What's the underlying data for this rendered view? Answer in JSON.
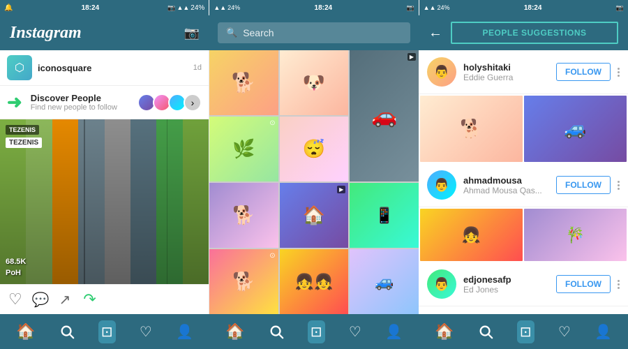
{
  "status_bars": [
    {
      "left_text": "🔔",
      "signal": "▲▲▲",
      "battery": "24%",
      "time": "18:24",
      "extra_icon": "📷"
    },
    {
      "signal": "▲▲▲",
      "battery": "24%",
      "time": "18:24",
      "extra_icon": "📷"
    },
    {
      "signal": "▲▲▲",
      "battery": "24%",
      "time": "18:24",
      "extra_icon": "📷"
    }
  ],
  "nav": {
    "logo": "Instagram",
    "search_placeholder": "Search",
    "people_suggestions_label": "PEOPLE SUGGESTIONS",
    "back_arrow": "←"
  },
  "left_post": {
    "username": "iconosquare",
    "time_ago": "1d",
    "tezenis_badge": "TEZENIS",
    "tezenis_tag": "TEZENIS",
    "stats": "68.5K\nPoH",
    "like_icon": "♡",
    "comment_icon": "💬",
    "share_icon": "↗"
  },
  "discover_people": {
    "title": "Discover People",
    "subtitle": "Find new people to follow",
    "arrow": "→"
  },
  "suggestions": [
    {
      "username": "holyshitaki",
      "full_name": "Eddie Guerra",
      "follow_label": "FOLLOW"
    },
    {
      "username": "ahmadmousa",
      "full_name": "Ahmad Mousa Qas...",
      "follow_label": "FOLLOW"
    },
    {
      "username": "edjonesafp",
      "full_name": "Ed Jones",
      "follow_label": "FOLLOW"
    }
  ],
  "bottom_nav_icons": [
    "🏠",
    "🔍",
    "⊡",
    "♡",
    "👤"
  ],
  "grid_cells": [
    {
      "type": "dog",
      "color": "dog1",
      "span": "normal"
    },
    {
      "type": "dog",
      "color": "dog2",
      "span": "normal"
    },
    {
      "type": "house",
      "color": "house1",
      "span": "tall"
    },
    {
      "type": "dog",
      "color": "dog3",
      "span": "normal"
    },
    {
      "type": "dog",
      "color": "dog4",
      "span": "normal"
    },
    {
      "type": "green_field",
      "color": "dog5",
      "span": "normal"
    },
    {
      "type": "dog",
      "color": "dog6",
      "span": "normal"
    },
    {
      "type": "dog_covered",
      "color": "dog7",
      "span": "normal"
    },
    {
      "type": "photo_app",
      "color": "dog8",
      "span": "normal"
    },
    {
      "type": "dog",
      "color": "dog9",
      "span": "normal"
    },
    {
      "type": "girls",
      "color": "rg3",
      "span": "normal"
    },
    {
      "type": "car_trunk",
      "color": "rg4",
      "span": "normal"
    }
  ]
}
